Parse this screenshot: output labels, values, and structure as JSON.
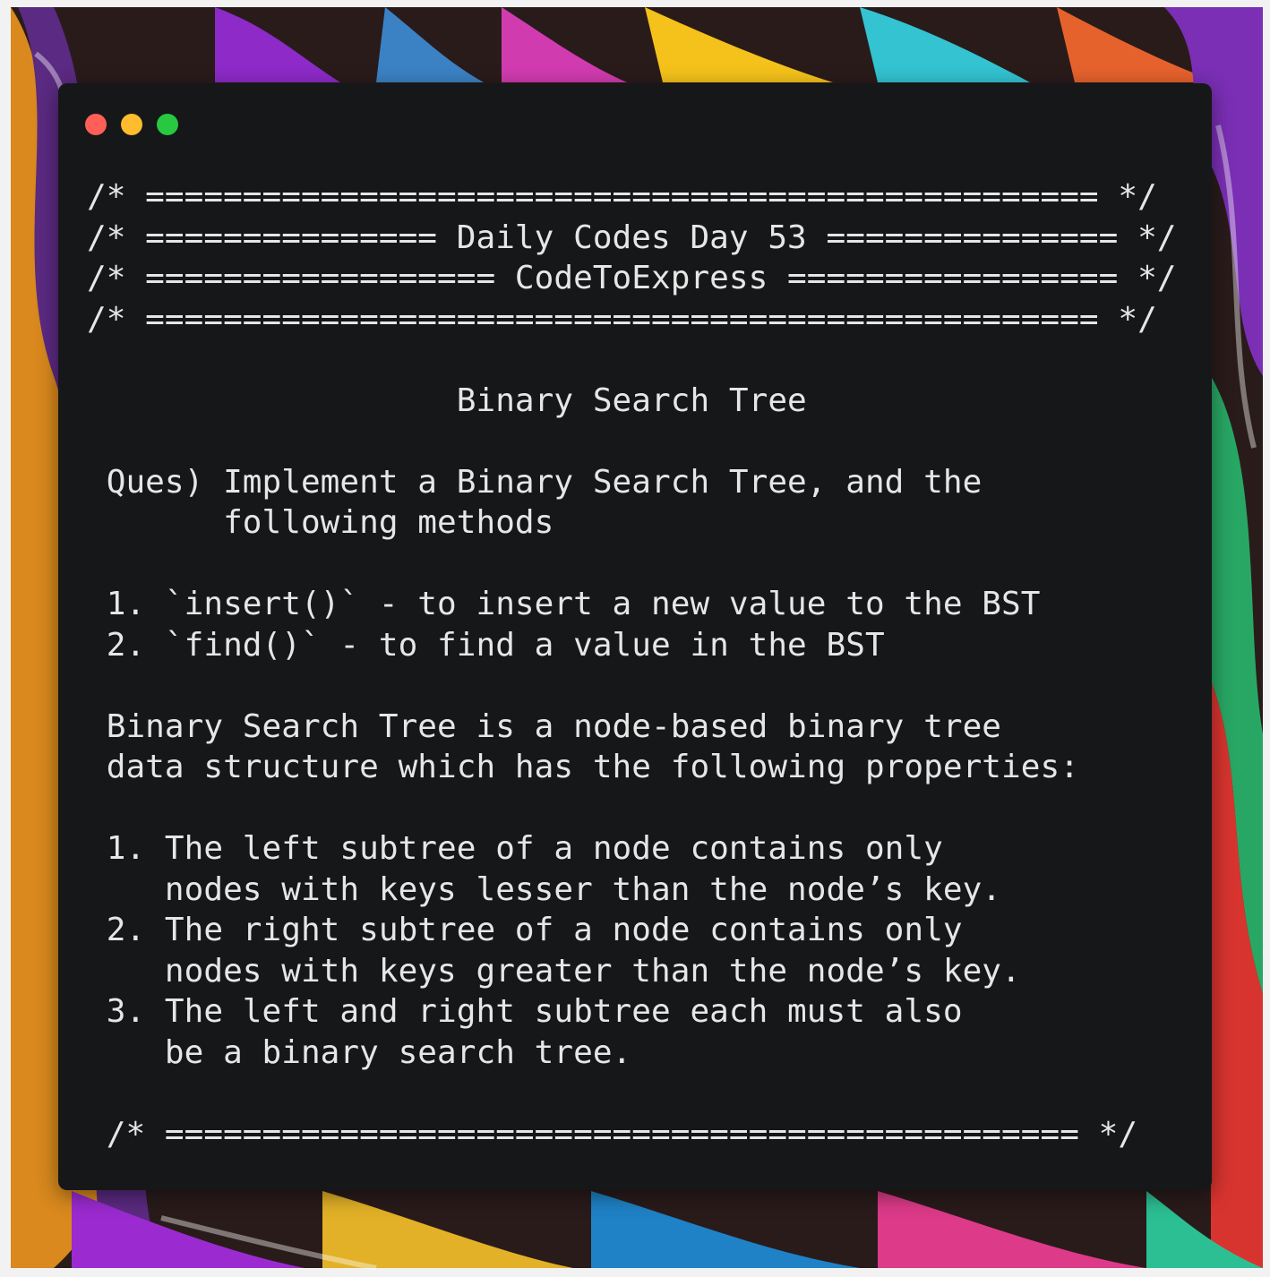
{
  "colors": {
    "window_background": "#161719",
    "text": "#e6e6e6",
    "close_dot": "#ff5f57",
    "minimize_dot": "#febc2e",
    "zoom_dot": "#28c840"
  },
  "window_controls": [
    "close-dot",
    "minimize-dot",
    "zoom-dot"
  ],
  "code_lines": [
    "/* ================================================= */",
    "/* =============== Daily Codes Day 53 =============== */",
    "/* ================== CodeToExpress ================= */",
    "/* ================================================= */",
    "",
    "                   Binary Search Tree",
    "",
    " Ques) Implement a Binary Search Tree, and the",
    "       following methods",
    "",
    " 1. `insert()` - to insert a new value to the BST",
    " 2. `find()` - to find a value in the BST",
    "",
    " Binary Search Tree is a node-based binary tree",
    " data structure which has the following properties:",
    "",
    " 1. The left subtree of a node contains only",
    "    nodes with keys lesser than the node’s key.",
    " 2. The right subtree of a node contains only",
    "    nodes with keys greater than the node’s key.",
    " 3. The left and right subtree each must also",
    "    be a binary search tree.",
    "",
    " /* =============================================== */"
  ]
}
